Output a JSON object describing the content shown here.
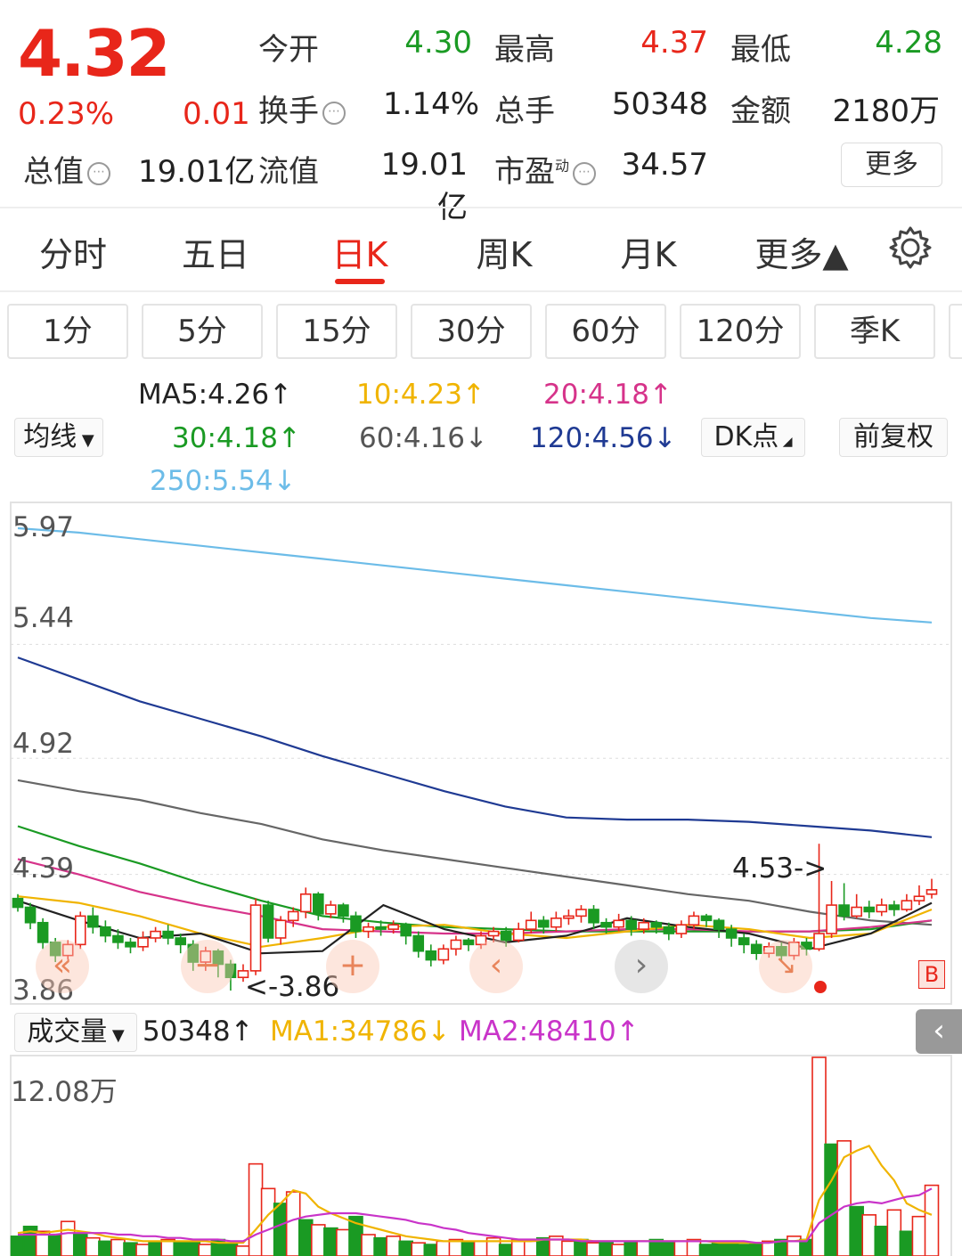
{
  "quote": {
    "price": "4.32",
    "change_pct": "0.23%",
    "change_abs": "0.01",
    "open_label": "今开",
    "open_value": "4.30",
    "high_label": "最高",
    "high_value": "4.37",
    "low_label": "最低",
    "low_value": "4.28",
    "turnover_label": "换手",
    "turnover_value": "1.14%",
    "volume_label": "总手",
    "volume_value": "50348",
    "amount_label": "金额",
    "amount_value": "2180万",
    "mktcap_label": "总值",
    "mktcap_value": "19.01亿",
    "float_label": "流值",
    "float_value": "19.01亿",
    "pe_label": "市盈",
    "pe_sup": "动",
    "pe_value": "34.57",
    "more_label": "更多"
  },
  "tabs": [
    "分时",
    "五日",
    "日K",
    "周K",
    "月K",
    "更多▲"
  ],
  "active_tab": "日K",
  "periods": [
    "1分",
    "5分",
    "15分",
    "30分",
    "60分",
    "120分",
    "季K"
  ],
  "indicators": {
    "ma_selector": "均线",
    "ma5": "MA5:4.26↑",
    "ma10": "10:4.23↑",
    "ma20": "20:4.18↑",
    "ma30": "30:4.18↑",
    "ma60": "60:4.16↓",
    "ma120": "120:4.56↓",
    "ma250": "250:5.54↓",
    "dk_selector": "DK点",
    "adjust": "前复权"
  },
  "colors": {
    "ma5": "#222222",
    "ma10": "#f0b400",
    "ma20": "#d6338a",
    "ma30": "#1a9a23",
    "ma60": "#666666",
    "ma120": "#1f3a93",
    "ma250": "#6cbce8",
    "up": "#e8261a",
    "down": "#1a9a23"
  },
  "price_axis": [
    "5.97",
    "5.44",
    "4.92",
    "4.39",
    "3.86"
  ],
  "annotations": {
    "high_mark": "4.53->",
    "low_mark": "<-3.86",
    "buy_badge": "B"
  },
  "volume": {
    "selector": "成交量",
    "value": "50348↑",
    "ma1": "MA1:34786↓",
    "ma2": "MA2:48410↑",
    "max_label": "12.08万"
  },
  "chart_data": {
    "type": "candlestick",
    "ylim": [
      3.86,
      5.97
    ],
    "ma_lines": {
      "ma250": [
        5.97,
        5.95,
        5.92,
        5.89,
        5.86,
        5.83,
        5.8,
        5.77,
        5.74,
        5.71,
        5.68,
        5.65,
        5.62,
        5.59,
        5.56,
        5.54
      ],
      "ma120": [
        5.38,
        5.28,
        5.18,
        5.1,
        5.02,
        4.93,
        4.85,
        4.77,
        4.7,
        4.65,
        4.64,
        4.64,
        4.63,
        4.61,
        4.59,
        4.56
      ],
      "ma60": [
        4.82,
        4.77,
        4.73,
        4.67,
        4.62,
        4.55,
        4.5,
        4.46,
        4.42,
        4.38,
        4.34,
        4.3,
        4.27,
        4.22,
        4.18,
        4.16
      ],
      "ma30": [
        4.61,
        4.52,
        4.44,
        4.35,
        4.27,
        4.2,
        4.17,
        4.15,
        4.14,
        4.13,
        4.13,
        4.13,
        4.13,
        4.13,
        4.14,
        4.18
      ],
      "ma20": [
        4.46,
        4.39,
        4.31,
        4.25,
        4.2,
        4.14,
        4.13,
        4.12,
        4.12,
        4.13,
        4.14,
        4.14,
        4.13,
        4.13,
        4.15,
        4.18
      ],
      "ma10": [
        4.29,
        4.26,
        4.2,
        4.12,
        4.06,
        4.1,
        4.15,
        4.16,
        4.12,
        4.1,
        4.13,
        4.16,
        4.14,
        4.1,
        4.12,
        4.23
      ],
      "ma5": [
        4.27,
        4.18,
        4.1,
        4.12,
        4.03,
        4.04,
        4.25,
        4.14,
        4.08,
        4.11,
        4.19,
        4.15,
        4.12,
        4.05,
        4.12,
        4.26
      ]
    },
    "candles": [
      [
        4.28,
        4.24,
        4.3,
        4.22
      ],
      [
        4.24,
        4.17,
        4.26,
        4.14
      ],
      [
        4.17,
        4.08,
        4.19,
        4.05
      ],
      [
        4.08,
        4.02,
        4.1,
        3.99
      ],
      [
        4.02,
        4.07,
        4.09,
        4.0
      ],
      [
        4.07,
        4.2,
        4.22,
        4.05
      ],
      [
        4.2,
        4.15,
        4.24,
        4.12
      ],
      [
        4.15,
        4.11,
        4.18,
        4.08
      ],
      [
        4.11,
        4.08,
        4.14,
        4.05
      ],
      [
        4.08,
        4.06,
        4.1,
        4.03
      ],
      [
        4.06,
        4.1,
        4.13,
        4.04
      ],
      [
        4.1,
        4.13,
        4.15,
        4.08
      ],
      [
        4.13,
        4.1,
        4.16,
        4.07
      ],
      [
        4.1,
        4.07,
        4.12,
        4.03
      ],
      [
        4.07,
        3.99,
        4.09,
        3.95
      ],
      [
        3.99,
        4.04,
        4.06,
        3.95
      ],
      [
        4.04,
        3.98,
        4.05,
        3.92
      ],
      [
        3.98,
        3.92,
        4.0,
        3.86
      ],
      [
        3.92,
        3.95,
        3.98,
        3.9
      ],
      [
        3.95,
        4.25,
        4.28,
        3.93
      ],
      [
        4.25,
        4.1,
        4.27,
        4.08
      ],
      [
        4.1,
        4.18,
        4.2,
        4.07
      ],
      [
        4.18,
        4.22,
        4.24,
        4.15
      ],
      [
        4.22,
        4.3,
        4.33,
        4.19
      ],
      [
        4.3,
        4.21,
        4.31,
        4.18
      ],
      [
        4.21,
        4.25,
        4.27,
        4.19
      ],
      [
        4.25,
        4.2,
        4.26,
        4.17
      ],
      [
        4.2,
        4.13,
        4.22,
        4.1
      ],
      [
        4.13,
        4.15,
        4.17,
        4.1
      ],
      [
        4.15,
        4.14,
        4.18,
        4.11
      ],
      [
        4.14,
        4.16,
        4.18,
        4.12
      ],
      [
        4.16,
        4.11,
        4.17,
        4.07
      ],
      [
        4.11,
        4.04,
        4.13,
        4.01
      ],
      [
        4.04,
        4.0,
        4.07,
        3.97
      ],
      [
        4.0,
        4.05,
        4.07,
        3.98
      ],
      [
        4.05,
        4.09,
        4.11,
        4.02
      ],
      [
        4.09,
        4.07,
        4.1,
        4.04
      ],
      [
        4.07,
        4.11,
        4.13,
        4.05
      ],
      [
        4.11,
        4.13,
        4.15,
        4.08
      ],
      [
        4.13,
        4.09,
        4.15,
        4.06
      ],
      [
        4.09,
        4.14,
        4.17,
        4.08
      ],
      [
        4.14,
        4.18,
        4.22,
        4.12
      ],
      [
        4.18,
        4.15,
        4.2,
        4.12
      ],
      [
        4.15,
        4.19,
        4.22,
        4.13
      ],
      [
        4.19,
        4.2,
        4.23,
        4.16
      ],
      [
        4.2,
        4.23,
        4.25,
        4.17
      ],
      [
        4.23,
        4.17,
        4.25,
        4.14
      ],
      [
        4.17,
        4.15,
        4.19,
        4.12
      ],
      [
        4.15,
        4.18,
        4.21,
        4.13
      ],
      [
        4.18,
        4.14,
        4.2,
        4.11
      ],
      [
        4.14,
        4.17,
        4.19,
        4.12
      ],
      [
        4.17,
        4.15,
        4.18,
        4.12
      ],
      [
        4.15,
        4.12,
        4.17,
        4.09
      ],
      [
        4.12,
        4.16,
        4.18,
        4.1
      ],
      [
        4.16,
        4.2,
        4.22,
        4.14
      ],
      [
        4.2,
        4.18,
        4.21,
        4.15
      ],
      [
        4.18,
        4.14,
        4.19,
        4.1
      ],
      [
        4.14,
        4.1,
        4.16,
        4.06
      ],
      [
        4.1,
        4.07,
        4.12,
        4.03
      ],
      [
        4.07,
        4.03,
        4.09,
        4.0
      ],
      [
        4.03,
        4.06,
        4.08,
        4.01
      ],
      [
        4.06,
        4.02,
        4.08,
        3.99
      ],
      [
        4.02,
        4.08,
        4.1,
        4.0
      ],
      [
        4.08,
        4.05,
        4.1,
        4.02
      ],
      [
        4.05,
        4.12,
        4.53,
        4.04
      ],
      [
        4.12,
        4.25,
        4.36,
        4.1
      ],
      [
        4.25,
        4.2,
        4.35,
        4.18
      ],
      [
        4.2,
        4.24,
        4.3,
        4.19
      ],
      [
        4.24,
        4.22,
        4.27,
        4.19
      ],
      [
        4.22,
        4.25,
        4.28,
        4.2
      ],
      [
        4.25,
        4.23,
        4.27,
        4.2
      ],
      [
        4.23,
        4.27,
        4.3,
        4.22
      ],
      [
        4.27,
        4.29,
        4.34,
        4.25
      ],
      [
        4.3,
        4.32,
        4.37,
        4.28
      ]
    ],
    "volumes": [
      [
        1.2,
        0
      ],
      [
        1.8,
        0
      ],
      [
        1.5,
        1
      ],
      [
        1.3,
        0
      ],
      [
        2.1,
        1
      ],
      [
        1.4,
        0
      ],
      [
        1.1,
        1
      ],
      [
        0.9,
        0
      ],
      [
        1.0,
        1
      ],
      [
        0.8,
        0
      ],
      [
        0.7,
        1
      ],
      [
        0.9,
        0
      ],
      [
        1.0,
        1
      ],
      [
        0.8,
        0
      ],
      [
        0.9,
        0
      ],
      [
        0.7,
        1
      ],
      [
        1.0,
        0
      ],
      [
        0.8,
        0
      ],
      [
        0.6,
        1
      ],
      [
        5.6,
        1
      ],
      [
        4.1,
        1
      ],
      [
        3.2,
        0
      ],
      [
        3.9,
        1
      ],
      [
        2.2,
        0
      ],
      [
        1.9,
        1
      ],
      [
        1.7,
        0
      ],
      [
        1.6,
        1
      ],
      [
        2.4,
        0
      ],
      [
        1.3,
        1
      ],
      [
        1.1,
        0
      ],
      [
        1.2,
        1
      ],
      [
        0.9,
        0
      ],
      [
        0.8,
        1
      ],
      [
        0.7,
        0
      ],
      [
        0.9,
        1
      ],
      [
        1.0,
        1
      ],
      [
        0.8,
        0
      ],
      [
        0.9,
        1
      ],
      [
        1.1,
        1
      ],
      [
        0.7,
        0
      ],
      [
        1.0,
        1
      ],
      [
        0.9,
        1
      ],
      [
        1.1,
        0
      ],
      [
        1.2,
        1
      ],
      [
        0.9,
        1
      ],
      [
        1.0,
        0
      ],
      [
        0.8,
        1
      ],
      [
        0.9,
        0
      ],
      [
        0.7,
        1
      ],
      [
        0.8,
        0
      ],
      [
        0.9,
        1
      ],
      [
        1.0,
        0
      ],
      [
        0.8,
        0
      ],
      [
        0.9,
        1
      ],
      [
        1.0,
        1
      ],
      [
        0.7,
        0
      ],
      [
        0.8,
        0
      ],
      [
        0.9,
        0
      ],
      [
        0.7,
        0
      ],
      [
        0.8,
        0
      ],
      [
        0.9,
        1
      ],
      [
        1.0,
        0
      ],
      [
        1.2,
        1
      ],
      [
        1.0,
        0
      ],
      [
        12.08,
        1
      ],
      [
        6.8,
        0
      ],
      [
        7.0,
        1
      ],
      [
        3.0,
        0
      ],
      [
        2.5,
        1
      ],
      [
        1.8,
        0
      ],
      [
        2.8,
        1
      ],
      [
        1.5,
        0
      ],
      [
        2.4,
        1
      ],
      [
        4.3,
        1
      ]
    ],
    "vol_ma1": [
      1.4,
      1.5,
      1.4,
      1.5,
      1.6,
      1.5,
      1.4,
      1.2,
      1.1,
      1.0,
      0.9,
      0.9,
      0.9,
      0.9,
      0.9,
      0.9,
      0.8,
      0.8,
      0.8,
      1.6,
      2.5,
      3.2,
      4.0,
      3.8,
      3.0,
      2.6,
      2.3,
      2.0,
      1.8,
      1.6,
      1.4,
      1.2,
      1.1,
      1.0,
      0.9,
      0.9,
      0.9,
      0.9,
      0.9,
      0.9,
      0.9,
      0.9,
      1.0,
      1.0,
      1.0,
      1.0,
      0.9,
      0.9,
      0.9,
      0.9,
      0.9,
      0.9,
      0.9,
      0.9,
      0.9,
      0.9,
      0.8,
      0.8,
      0.8,
      0.8,
      0.8,
      0.9,
      0.9,
      1.0,
      3.4,
      4.6,
      6.0,
      6.4,
      6.7,
      5.5,
      4.6,
      3.2,
      2.8,
      2.5
    ],
    "vol_ma2": [
      1.3,
      1.3,
      1.3,
      1.3,
      1.4,
      1.4,
      1.4,
      1.4,
      1.3,
      1.3,
      1.2,
      1.2,
      1.1,
      1.1,
      1.0,
      1.0,
      1.0,
      0.9,
      0.9,
      1.3,
      1.6,
      1.9,
      2.2,
      2.4,
      2.5,
      2.6,
      2.6,
      2.6,
      2.5,
      2.4,
      2.3,
      2.2,
      2.0,
      1.9,
      1.7,
      1.6,
      1.4,
      1.3,
      1.2,
      1.1,
      1.0,
      1.0,
      1.0,
      1.0,
      1.0,
      0.9,
      0.9,
      0.9,
      0.9,
      0.9,
      0.9,
      0.9,
      0.9,
      0.9,
      0.9,
      0.9,
      0.9,
      0.9,
      0.9,
      0.8,
      0.8,
      0.9,
      0.9,
      0.9,
      2.0,
      2.5,
      3.0,
      3.2,
      3.3,
      3.2,
      3.4,
      3.6,
      3.7,
      4.1
    ]
  }
}
